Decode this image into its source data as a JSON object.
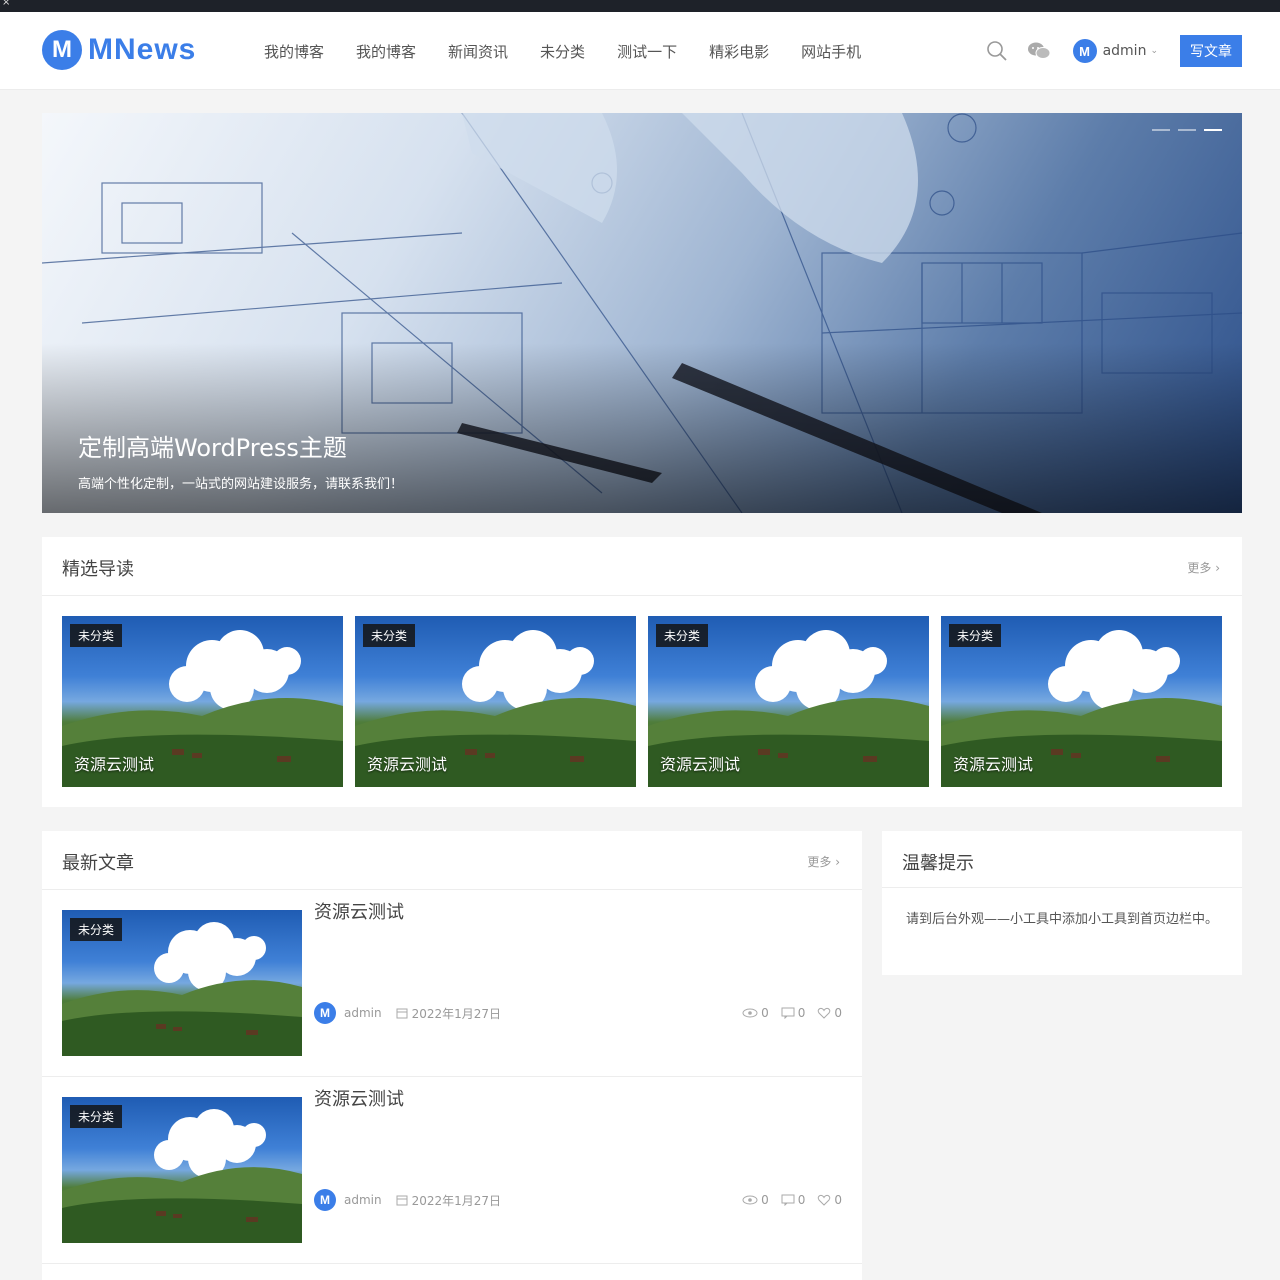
{
  "topbar": {
    "close": "×"
  },
  "brand": {
    "mark": "M",
    "name": "MNews",
    "color": "#3b7ee8"
  },
  "nav": [
    "我的博客",
    "我的博客",
    "新闻资讯",
    "未分类",
    "测试一下",
    "精彩电影",
    "网站手机"
  ],
  "header": {
    "search_icon": "search-icon",
    "wechat_icon": "wechat-icon",
    "user": {
      "avatar": "M",
      "name": "admin"
    },
    "write_label": "写文章"
  },
  "hero": {
    "title": "定制高端WordPress主题",
    "subtitle": "高端个性化定制，一站式的网站建设服务，请联系我们！",
    "slides": 3,
    "active_slide": 3
  },
  "featured": {
    "heading": "精选导读",
    "more": "更多",
    "items": [
      {
        "tag": "未分类",
        "title": "资源云测试"
      },
      {
        "tag": "未分类",
        "title": "资源云测试"
      },
      {
        "tag": "未分类",
        "title": "资源云测试"
      },
      {
        "tag": "未分类",
        "title": "资源云测试"
      }
    ]
  },
  "latest": {
    "heading": "最新文章",
    "more": "更多",
    "posts": [
      {
        "tag": "未分类",
        "title": "资源云测试",
        "author": "admin",
        "date": "2022年1月27日",
        "views": "0",
        "comments": "0",
        "likes": "0"
      },
      {
        "tag": "未分类",
        "title": "资源云测试",
        "author": "admin",
        "date": "2022年1月27日",
        "views": "0",
        "comments": "0",
        "likes": "0"
      }
    ]
  },
  "sidebar": {
    "heading": "温馨提示",
    "text": "请到后台外观——小工具中添加小工具到首页边栏中。"
  }
}
